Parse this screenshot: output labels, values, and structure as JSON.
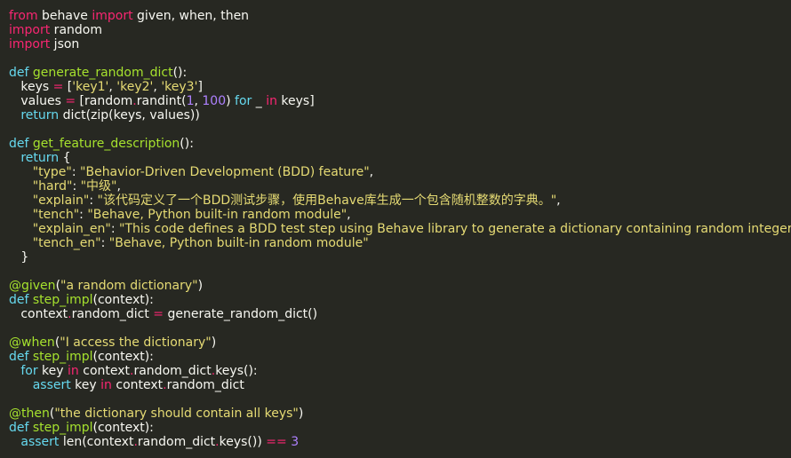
{
  "lines": [
    [
      [
        "kw",
        "from"
      ],
      [
        "plain",
        " behave "
      ],
      [
        "kw",
        "import"
      ],
      [
        "plain",
        " given, when, then"
      ]
    ],
    [
      [
        "kw",
        "import"
      ],
      [
        "plain",
        " random"
      ]
    ],
    [
      [
        "kw",
        "import"
      ],
      [
        "plain",
        " json"
      ]
    ],
    [],
    [
      [
        "kw2",
        "def "
      ],
      [
        "fn",
        "generate_random_dict"
      ],
      [
        "plain",
        "():"
      ]
    ],
    [
      [
        "plain",
        "   keys "
      ],
      [
        "op",
        "="
      ],
      [
        "plain",
        " ["
      ],
      [
        "str",
        "'key1'"
      ],
      [
        "plain",
        ", "
      ],
      [
        "str",
        "'key2'"
      ],
      [
        "plain",
        ", "
      ],
      [
        "str",
        "'key3'"
      ],
      [
        "plain",
        "]"
      ]
    ],
    [
      [
        "plain",
        "   values "
      ],
      [
        "op",
        "="
      ],
      [
        "plain",
        " [random"
      ],
      [
        "op",
        "."
      ],
      [
        "plain",
        "randint("
      ],
      [
        "num",
        "1"
      ],
      [
        "plain",
        ", "
      ],
      [
        "num",
        "100"
      ],
      [
        "plain",
        ") "
      ],
      [
        "kw2",
        "for"
      ],
      [
        "plain",
        " _ "
      ],
      [
        "kw",
        "in"
      ],
      [
        "plain",
        " keys]"
      ]
    ],
    [
      [
        "plain",
        "   "
      ],
      [
        "kw2",
        "return"
      ],
      [
        "plain",
        " dict(zip(keys, values))"
      ]
    ],
    [],
    [
      [
        "kw2",
        "def "
      ],
      [
        "fn",
        "get_feature_description"
      ],
      [
        "plain",
        "():"
      ]
    ],
    [
      [
        "plain",
        "   "
      ],
      [
        "kw2",
        "return"
      ],
      [
        "plain",
        " {"
      ]
    ],
    [
      [
        "plain",
        "      "
      ],
      [
        "str",
        "\"type\""
      ],
      [
        "plain",
        ": "
      ],
      [
        "str",
        "\"Behavior-Driven Development (BDD) feature\""
      ],
      [
        "plain",
        ","
      ]
    ],
    [
      [
        "plain",
        "      "
      ],
      [
        "str",
        "\"hard\""
      ],
      [
        "plain",
        ": "
      ],
      [
        "str",
        "\"中级\""
      ],
      [
        "plain",
        ","
      ]
    ],
    [
      [
        "plain",
        "      "
      ],
      [
        "str",
        "\"explain\""
      ],
      [
        "plain",
        ": "
      ],
      [
        "str",
        "\"该代码定义了一个BDD测试步骤，使用Behave库生成一个包含随机整数的字典。\""
      ],
      [
        "plain",
        ","
      ]
    ],
    [
      [
        "plain",
        "      "
      ],
      [
        "str",
        "\"tench\""
      ],
      [
        "plain",
        ": "
      ],
      [
        "str",
        "\"Behave, Python built-in random module\""
      ],
      [
        "plain",
        ","
      ]
    ],
    [
      [
        "plain",
        "      "
      ],
      [
        "str",
        "\"explain_en\""
      ],
      [
        "plain",
        ": "
      ],
      [
        "str",
        "\"This code defines a BDD test step using Behave library to generate a dictionary containing random integers.\""
      ],
      [
        "plain",
        ","
      ]
    ],
    [
      [
        "plain",
        "      "
      ],
      [
        "str",
        "\"tench_en\""
      ],
      [
        "plain",
        ": "
      ],
      [
        "str",
        "\"Behave, Python built-in random module\""
      ]
    ],
    [
      [
        "plain",
        "   }"
      ]
    ],
    [],
    [
      [
        "fn",
        "@given"
      ],
      [
        "plain",
        "("
      ],
      [
        "str",
        "\"a random dictionary\""
      ],
      [
        "plain",
        ")"
      ]
    ],
    [
      [
        "kw2",
        "def "
      ],
      [
        "fn",
        "step_impl"
      ],
      [
        "plain",
        "(context):"
      ]
    ],
    [
      [
        "plain",
        "   context"
      ],
      [
        "op",
        "."
      ],
      [
        "plain",
        "random_dict "
      ],
      [
        "op",
        "="
      ],
      [
        "plain",
        " generate_random_dict()"
      ]
    ],
    [],
    [
      [
        "fn",
        "@when"
      ],
      [
        "plain",
        "("
      ],
      [
        "str",
        "\"I access the dictionary\""
      ],
      [
        "plain",
        ")"
      ]
    ],
    [
      [
        "kw2",
        "def "
      ],
      [
        "fn",
        "step_impl"
      ],
      [
        "plain",
        "(context):"
      ]
    ],
    [
      [
        "plain",
        "   "
      ],
      [
        "kw2",
        "for"
      ],
      [
        "plain",
        " key "
      ],
      [
        "kw",
        "in"
      ],
      [
        "plain",
        " context"
      ],
      [
        "op",
        "."
      ],
      [
        "plain",
        "random_dict"
      ],
      [
        "op",
        "."
      ],
      [
        "plain",
        "keys():"
      ]
    ],
    [
      [
        "plain",
        "      "
      ],
      [
        "kw2",
        "assert"
      ],
      [
        "plain",
        " key "
      ],
      [
        "kw",
        "in"
      ],
      [
        "plain",
        " context"
      ],
      [
        "op",
        "."
      ],
      [
        "plain",
        "random_dict"
      ]
    ],
    [],
    [
      [
        "fn",
        "@then"
      ],
      [
        "plain",
        "("
      ],
      [
        "str",
        "\"the dictionary should contain all keys\""
      ],
      [
        "plain",
        ")"
      ]
    ],
    [
      [
        "kw2",
        "def "
      ],
      [
        "fn",
        "step_impl"
      ],
      [
        "plain",
        "(context):"
      ]
    ],
    [
      [
        "plain",
        "   "
      ],
      [
        "kw2",
        "assert"
      ],
      [
        "plain",
        " len(context"
      ],
      [
        "op",
        "."
      ],
      [
        "plain",
        "random_dict"
      ],
      [
        "op",
        "."
      ],
      [
        "plain",
        "keys()) "
      ],
      [
        "op",
        "=="
      ],
      [
        "plain",
        " "
      ],
      [
        "num",
        "3"
      ]
    ]
  ]
}
